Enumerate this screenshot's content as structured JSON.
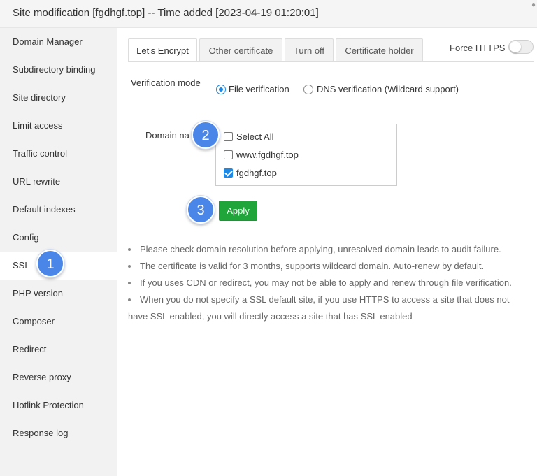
{
  "window": {
    "title": "Site modification [fgdhgf.top] -- Time added [2023-04-19 01:20:01]"
  },
  "sidebar": {
    "items": [
      {
        "label": "Domain Manager"
      },
      {
        "label": "Subdirectory binding"
      },
      {
        "label": "Site directory"
      },
      {
        "label": "Limit access"
      },
      {
        "label": "Traffic control"
      },
      {
        "label": "URL rewrite"
      },
      {
        "label": "Default indexes"
      },
      {
        "label": "Config"
      },
      {
        "label": "SSL",
        "active": true
      },
      {
        "label": "PHP version"
      },
      {
        "label": "Composer"
      },
      {
        "label": "Redirect"
      },
      {
        "label": "Reverse proxy"
      },
      {
        "label": "Hotlink Protection"
      },
      {
        "label": "Response log"
      }
    ]
  },
  "tabs": [
    {
      "label": "Let's Encrypt",
      "active": true
    },
    {
      "label": "Other certificate"
    },
    {
      "label": "Turn off"
    },
    {
      "label": "Certificate holder"
    }
  ],
  "force_https": {
    "label": "Force HTTPS",
    "enabled": false
  },
  "verification": {
    "label": "Verification mode",
    "options": [
      {
        "label": "File verification",
        "checked": true
      },
      {
        "label": "DNS verification (Wildcard support)",
        "checked": false
      }
    ]
  },
  "domains": {
    "label": "Domain na",
    "items": [
      {
        "label": "Select All",
        "checked": false
      },
      {
        "label": "www.fgdhgf.top",
        "checked": false
      },
      {
        "label": "fgdhgf.top",
        "checked": true
      }
    ]
  },
  "apply_label": "Apply",
  "notes": [
    "Please check domain resolution before applying, unresolved domain leads to audit failure.",
    "The certificate is valid for 3 months, supports wildcard domain. Auto-renew by default.",
    "If you uses CDN or redirect, you may not be able to apply and renew through file verification.",
    "When you do not specify a SSL default site, if you use HTTPS to access a site that does not have SSL enabled, you will directly access a site that has SSL enabled"
  ],
  "annotations": [
    "1",
    "2",
    "3"
  ],
  "colors": {
    "accent": "#1e88e5",
    "apply_green": "#20a53a",
    "badge_blue": "#4a86e8"
  }
}
